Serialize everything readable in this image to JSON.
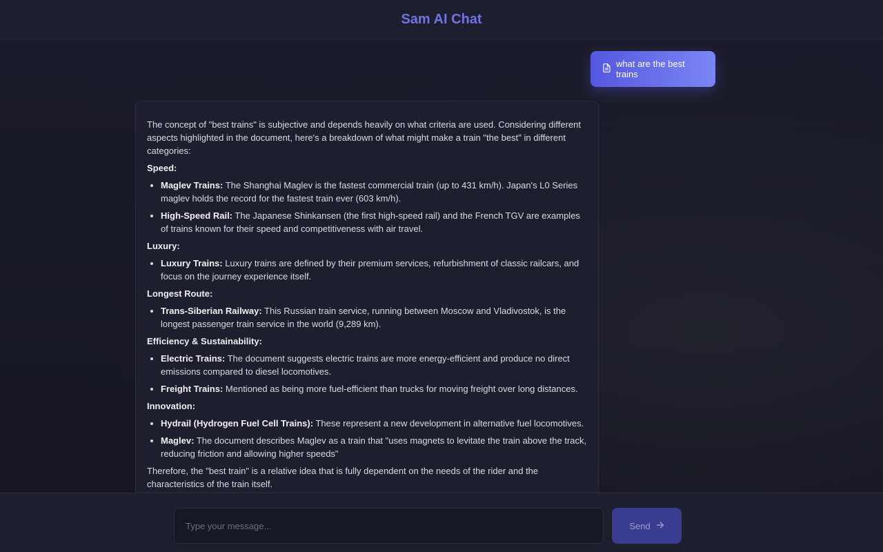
{
  "app": {
    "title": "Sam AI Chat"
  },
  "colors": {
    "accent": "#6e73e8",
    "user_bubble_start": "#5458e0",
    "user_bubble_end": "#7b86f2",
    "send_button": "#3a3d8f"
  },
  "user_message": {
    "icon": "document-icon",
    "text": "what are the best trains"
  },
  "assistant_message": {
    "intro": "The concept of \"best trains\" is subjective and depends heavily on what criteria are used. Considering different aspects highlighted in the document, here's a breakdown of what might make a train \"the best\" in different categories:",
    "sections": [
      {
        "heading": "Speed:",
        "items": [
          {
            "label": "Maglev Trains:",
            "text": " The Shanghai Maglev is the fastest commercial train (up to 431 km/h). Japan's L0 Series maglev holds the record for the fastest train ever (603 km/h)."
          },
          {
            "label": "High-Speed Rail:",
            "text": " The Japanese Shinkansen (the first high-speed rail) and the French TGV are examples of trains known for their speed and competitiveness with air travel."
          }
        ]
      },
      {
        "heading": "Luxury:",
        "items": [
          {
            "label": "Luxury Trains:",
            "text": " Luxury trains are defined by their premium services, refurbishment of classic railcars, and focus on the journey experience itself."
          }
        ]
      },
      {
        "heading": "Longest Route:",
        "items": [
          {
            "label": "Trans-Siberian Railway:",
            "text": " This Russian train service, running between Moscow and Vladivostok, is the longest passenger train service in the world (9,289 km)."
          }
        ]
      },
      {
        "heading": "Efficiency & Sustainability:",
        "items": [
          {
            "label": "Electric Trains:",
            "text": " The document suggests electric trains are more energy-efficient and produce no direct emissions compared to diesel locomotives."
          },
          {
            "label": "Freight Trains:",
            "text": " Mentioned as being more fuel-efficient than trucks for moving freight over long distances."
          }
        ]
      },
      {
        "heading": "Innovation:",
        "items": [
          {
            "label": "Hydrail (Hydrogen Fuel Cell Trains):",
            "text": " These represent a new development in alternative fuel locomotives."
          },
          {
            "label": "Maglev:",
            "text": " The document describes Maglev as a train that \"uses magnets to levitate the train above the track, reducing friction and allowing higher speeds\""
          }
        ]
      }
    ],
    "conclusion": "Therefore, the \"best train\" is a relative idea that is fully dependent on the needs of the rider and the characteristics of the train itself."
  },
  "composer": {
    "placeholder": "Type your message...",
    "value": "",
    "send_label": "Send",
    "send_icon": "arrow-right-icon"
  }
}
